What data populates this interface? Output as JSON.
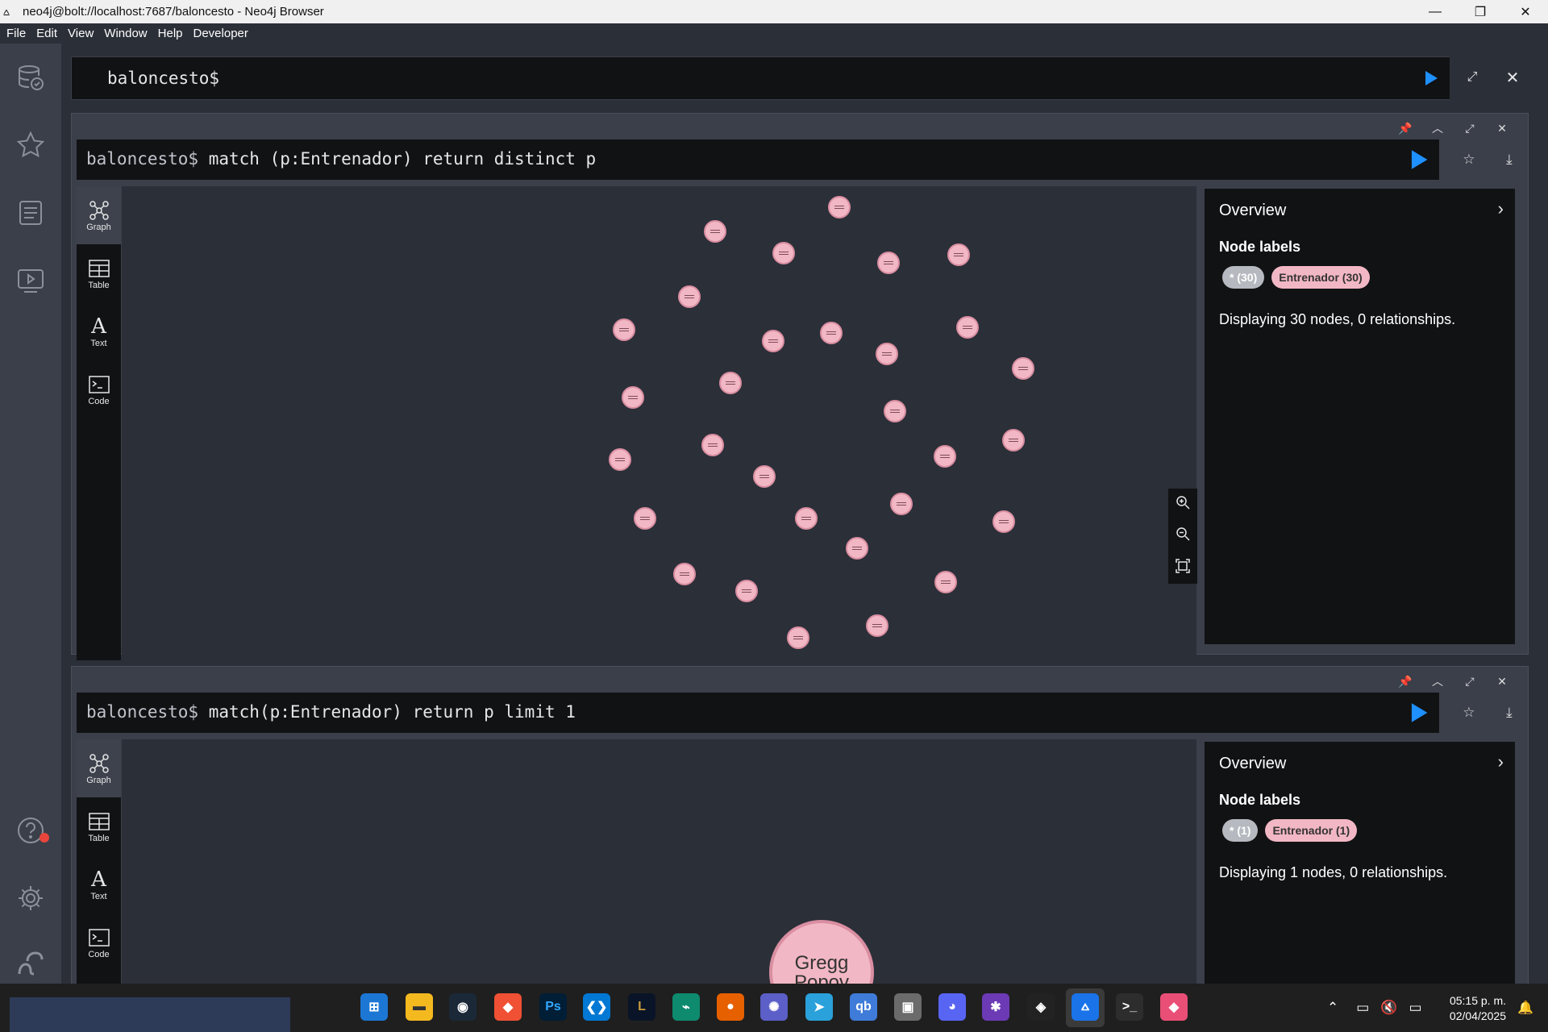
{
  "window": {
    "title": "neo4j@bolt://localhost:7687/baloncesto - Neo4j Browser",
    "app_icon": "neo4j-icon"
  },
  "menu": [
    "File",
    "Edit",
    "View",
    "Window",
    "Help",
    "Developer"
  ],
  "sidebar": {
    "icons": [
      "database-icon",
      "star-icon",
      "document-icon",
      "play-icon",
      "help-icon",
      "gear-icon",
      "neo4j-logo-icon"
    ]
  },
  "editor": {
    "prompt": "baloncesto$"
  },
  "frames": [
    {
      "prefix": "baloncesto$",
      "query": "match (p:Entrenador) return distinct p",
      "views": [
        {
          "label": "Graph"
        },
        {
          "label": "Table"
        },
        {
          "label": "Text"
        },
        {
          "label": "Code"
        }
      ],
      "overview": {
        "title": "Overview",
        "node_labels_title": "Node labels",
        "badge_all": "* (30)",
        "badge_label": "Entrenador (30)",
        "display_text": "Displaying 30 nodes, 0 relationships."
      },
      "node_count": 30,
      "node_color": "#f2b7c4"
    },
    {
      "prefix": "baloncesto$",
      "query": "match(p:Entrenador) return p limit 1",
      "views": [
        {
          "label": "Graph"
        },
        {
          "label": "Table"
        },
        {
          "label": "Text"
        },
        {
          "label": "Code"
        }
      ],
      "overview": {
        "title": "Overview",
        "node_labels_title": "Node labels",
        "badge_all": "* (1)",
        "badge_label": "Entrenador (1)",
        "display_text": "Displaying 1 nodes, 0 relationships."
      },
      "node_label": {
        "line1": "Gregg",
        "line2": "Popov"
      }
    }
  ],
  "taskbar": {
    "clock_time": "05:15 p. m.",
    "clock_date": "02/04/2025",
    "apps": [
      "windows-start-icon",
      "file-explorer-icon",
      "steam-icon",
      "git-icon",
      "photoshop-icon",
      "vscode-icon",
      "league-icon",
      "terminal-app-icon",
      "firefox-icon",
      "gear-app-icon",
      "telegram-icon",
      "qbittorrent-icon",
      "game-icon",
      "discord-icon",
      "web3-icon",
      "unity-icon",
      "neo4j-icon",
      "windows-terminal-icon",
      "git-kraken-icon"
    ]
  },
  "colors": {
    "accent": "#1e90ff",
    "node": "#f2b7c4",
    "panel": "#111214"
  }
}
